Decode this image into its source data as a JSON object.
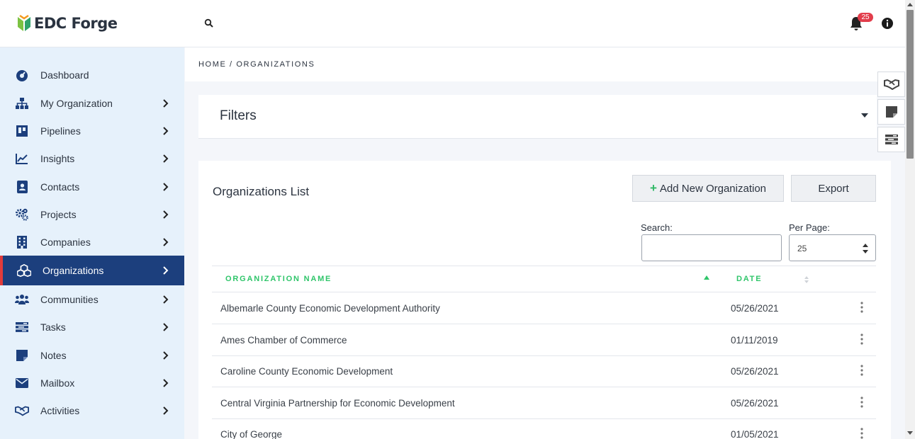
{
  "header": {
    "logo_text": "EDC Forge",
    "notification_count": "25"
  },
  "sidebar": {
    "items": [
      {
        "label": "Dashboard",
        "icon": "dashboard-icon"
      },
      {
        "label": "My Organization",
        "icon": "sitemap-icon"
      },
      {
        "label": "Pipelines",
        "icon": "board-icon"
      },
      {
        "label": "Insights",
        "icon": "chart-line-icon"
      },
      {
        "label": "Contacts",
        "icon": "contact-card-icon"
      },
      {
        "label": "Projects",
        "icon": "gears-icon"
      },
      {
        "label": "Companies",
        "icon": "building-icon"
      },
      {
        "label": "Organizations",
        "icon": "cubes-icon"
      },
      {
        "label": "Communities",
        "icon": "users-icon"
      },
      {
        "label": "Tasks",
        "icon": "tasks-icon"
      },
      {
        "label": "Notes",
        "icon": "sticky-note-icon"
      },
      {
        "label": "Mailbox",
        "icon": "envelope-icon"
      },
      {
        "label": "Activities",
        "icon": "handshake-icon"
      }
    ],
    "active": "Organizations"
  },
  "breadcrumb": "HOME / ORGANIZATIONS",
  "filters": {
    "title": "Filters"
  },
  "list": {
    "title": "Organizations List",
    "add_label": "Add New Organization",
    "export_label": "Export",
    "search_label": "Search:",
    "per_page_label": "Per Page:",
    "per_page_value": "25",
    "columns": [
      "ORGANIZATION NAME",
      "DATE"
    ],
    "rows": [
      {
        "name": "Albemarle County Economic Development Authority",
        "date": "05/26/2021"
      },
      {
        "name": "Ames Chamber of Commerce",
        "date": "01/11/2019"
      },
      {
        "name": "Caroline County Economic Development",
        "date": "05/26/2021"
      },
      {
        "name": "Central Virginia Partnership for Economic Development",
        "date": "05/26/2021"
      },
      {
        "name": "City of George",
        "date": "01/05/2021"
      }
    ]
  },
  "colors": {
    "sidebar_bg": "#e6f1fb",
    "active_bg": "#1c3f7d",
    "active_accent": "#e13b3b",
    "header_green": "#2fc56a",
    "badge_red": "#e23d4b"
  }
}
